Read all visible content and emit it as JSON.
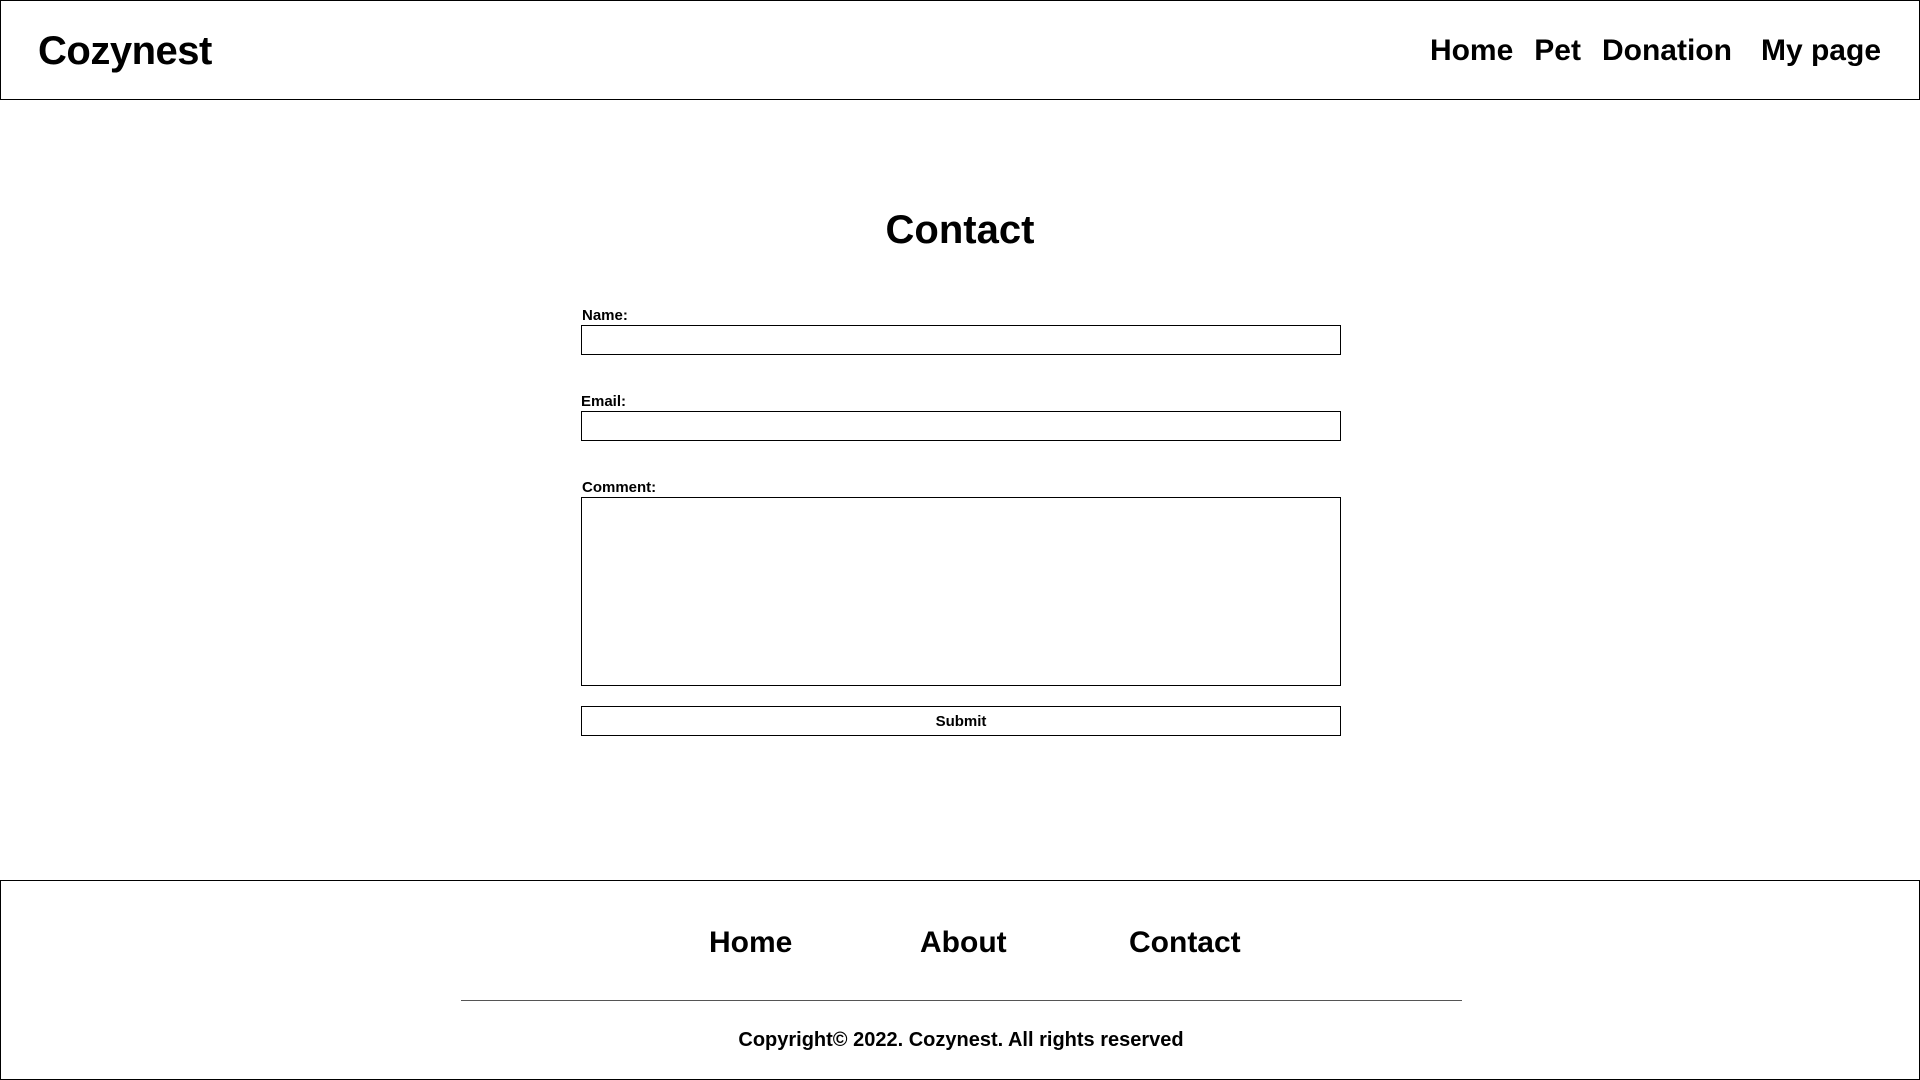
{
  "header": {
    "brand": "Cozynest",
    "nav": {
      "home": "Home",
      "pet": "Pet",
      "donation": "Donation",
      "mypage": "My page"
    }
  },
  "main": {
    "title": "Contact",
    "form": {
      "name_label": "Name:",
      "name_value": "",
      "email_label": "Email:",
      "email_value": "",
      "comment_label": "Comment:",
      "comment_value": "",
      "submit_label": "Submit"
    }
  },
  "footer": {
    "links": {
      "home": "Home",
      "about": "About",
      "contact": "Contact"
    },
    "copyright": "Copyright© 2022. Cozynest. All rights reserved"
  }
}
